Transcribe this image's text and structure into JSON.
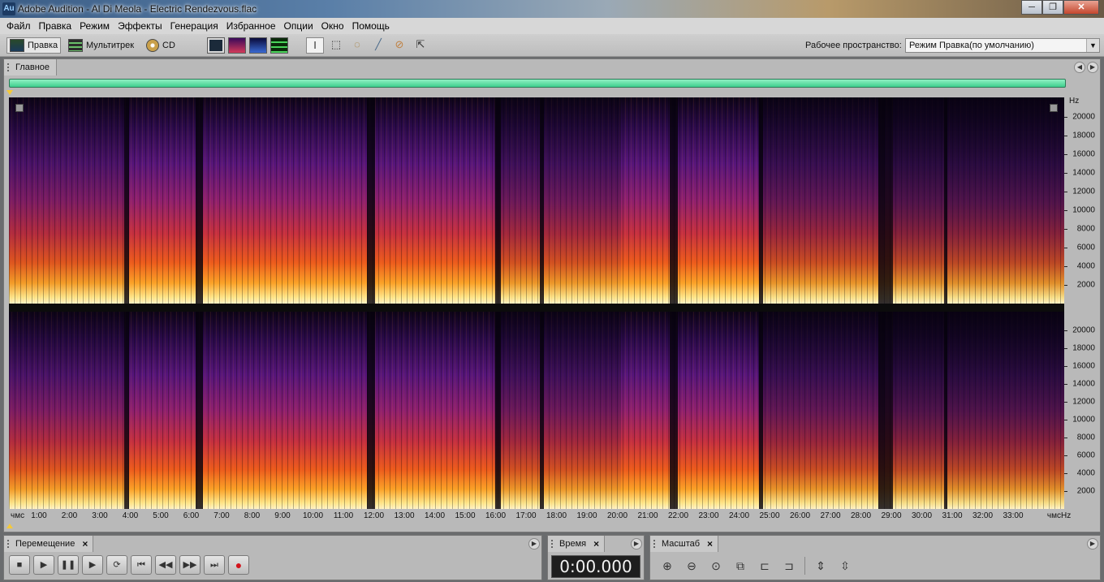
{
  "window": {
    "app_icon": "Au",
    "title": "Adobe Audition - Al Di Meola - Electric Rendezvous.flac",
    "minimize": "─",
    "maximize": "❐",
    "close": "✕"
  },
  "menu": [
    "Файл",
    "Правка",
    "Режим",
    "Эффекты",
    "Генерация",
    "Избранное",
    "Опции",
    "Окно",
    "Помощь"
  ],
  "toolbar": {
    "modes": [
      {
        "label": "Правка",
        "icon": "waveform-edit-icon",
        "active": true
      },
      {
        "label": "Мультитрек",
        "icon": "multitrack-icon",
        "active": false
      },
      {
        "label": "CD",
        "icon": "cd-icon",
        "active": false
      }
    ],
    "view_buttons": [
      "waveform-view-icon",
      "spectral-view-icon",
      "pan-view-icon",
      "phase-view-icon"
    ],
    "tools": [
      "time-selection-tool-icon",
      "marquee-tool-icon",
      "lasso-tool-icon",
      "brush-tool-icon",
      "spot-healing-tool-icon",
      "scrub-tool-icon"
    ],
    "workspace_label": "Рабочее пространство:",
    "workspace_value": "Режим Правка(по умолчанию)"
  },
  "main_panel": {
    "tab_label": "Главное",
    "freq_unit": "Hz",
    "freq_labels": [
      "20000",
      "18000",
      "16000",
      "14000",
      "12000",
      "10000",
      "8000",
      "6000",
      "4000",
      "2000"
    ],
    "freq_max": 22050,
    "time_start": "чмс",
    "time_end": "чмс",
    "time_labels": [
      "1:00",
      "2:00",
      "3:00",
      "4:00",
      "5:00",
      "6:00",
      "7:00",
      "8:00",
      "9:00",
      "10:00",
      "11:00",
      "12:00",
      "13:00",
      "14:00",
      "15:00",
      "16:00",
      "17:00",
      "18:00",
      "19:00",
      "20:00",
      "21:00",
      "22:00",
      "23:00",
      "24:00",
      "25:00",
      "26:00",
      "27:00",
      "28:00",
      "29:00",
      "30:00",
      "31:00",
      "32:00",
      "33:00"
    ]
  },
  "transport_panel": {
    "tab_label": "Перемещение",
    "close": "×",
    "buttons": [
      {
        "name": "stop-icon",
        "glyph": "■"
      },
      {
        "name": "play-icon",
        "glyph": "▶"
      },
      {
        "name": "pause-icon",
        "glyph": "❚❚"
      },
      {
        "name": "play-from-cursor-icon",
        "glyph": "▶"
      },
      {
        "name": "loop-icon",
        "glyph": "⟳"
      },
      {
        "name": "go-to-start-icon",
        "glyph": "⏮"
      },
      {
        "name": "rewind-icon",
        "glyph": "◀◀"
      },
      {
        "name": "fast-forward-icon",
        "glyph": "▶▶"
      },
      {
        "name": "go-to-end-icon",
        "glyph": "⏭"
      },
      {
        "name": "record-icon",
        "glyph": "●"
      }
    ]
  },
  "time_panel": {
    "tab_label": "Время",
    "close": "×",
    "value": "0:00.000"
  },
  "zoom_panel": {
    "tab_label": "Масштаб",
    "close": "×",
    "buttons": [
      "zoom-in-horizontal-icon",
      "zoom-out-horizontal-icon",
      "zoom-full-icon",
      "zoom-selection-icon",
      "zoom-to-left-edge-icon",
      "zoom-to-right-edge-icon",
      "zoom-in-vertical-icon",
      "zoom-out-vertical-icon"
    ]
  },
  "colors": {
    "overview": "#3fcf8e",
    "playhead": "#f4c93a",
    "time_display_bg": "#1e1e1e",
    "record": "#d3141c"
  }
}
